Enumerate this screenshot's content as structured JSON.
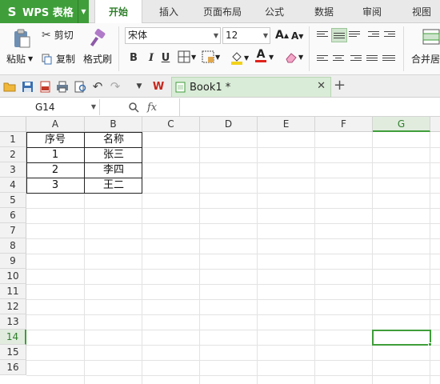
{
  "app": {
    "name": "WPS 表格",
    "logo": "S"
  },
  "tabs": [
    "开始",
    "插入",
    "页面布局",
    "公式",
    "数据",
    "审阅",
    "视图"
  ],
  "active_tab": "开始",
  "ribbon": {
    "paste_label": "粘贴",
    "cut_label": "剪切",
    "copy_label": "复制",
    "format_painter_label": "格式刷",
    "font_name": "宋体",
    "font_size": "12",
    "bold": "B",
    "italic": "I",
    "underline": "U",
    "merge_label": "合并居"
  },
  "document": {
    "tab_name": "Book1 *"
  },
  "formula_bar": {
    "cell_ref": "G14",
    "fx": "fx",
    "value": ""
  },
  "columns": [
    "A",
    "B",
    "C",
    "D",
    "E",
    "F",
    "G"
  ],
  "rows": [
    "1",
    "2",
    "3",
    "4",
    "5",
    "6",
    "7",
    "8",
    "9",
    "10",
    "11",
    "12",
    "13",
    "14",
    "15",
    "16"
  ],
  "selected": {
    "column": "G",
    "row": "14"
  },
  "table": {
    "header": [
      "序号",
      "名称"
    ],
    "rows": [
      [
        "1",
        "张三"
      ],
      [
        "2",
        "李四"
      ],
      [
        "3",
        "王二"
      ]
    ]
  },
  "colors": {
    "accent": "#3f9e3a",
    "selected_header": "#e1ecdf"
  }
}
